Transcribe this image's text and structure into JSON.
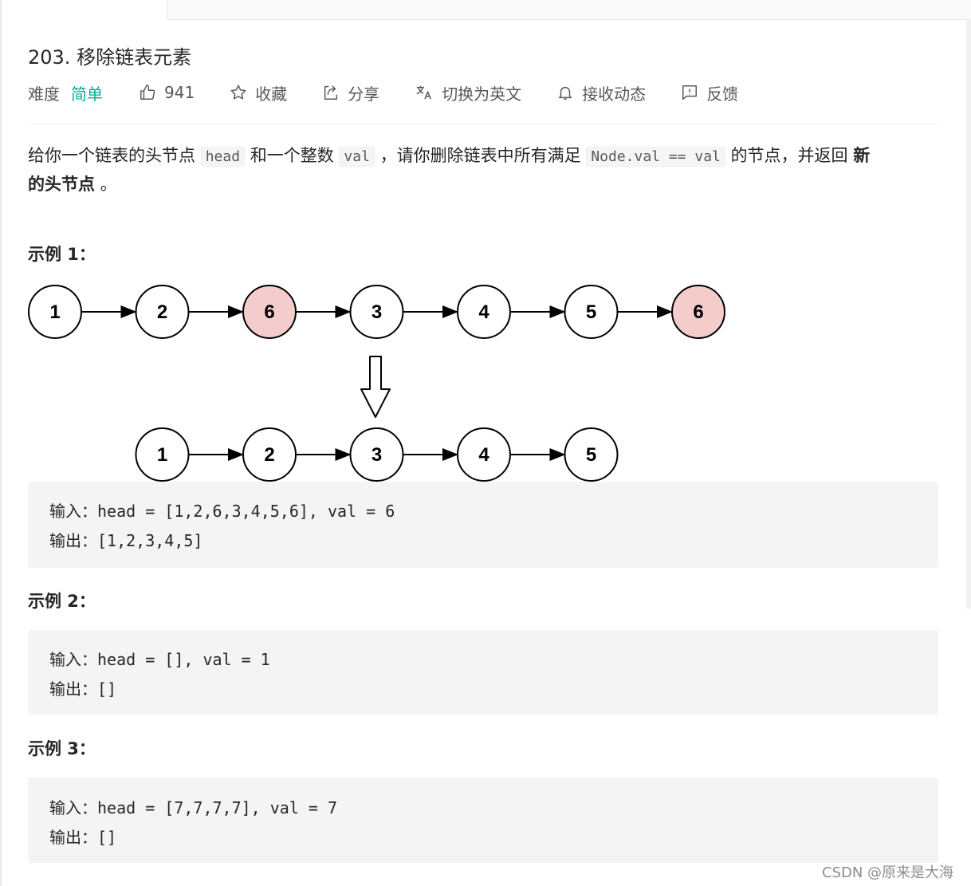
{
  "problem": {
    "title": "203. 移除链表元素",
    "difficulty_label": "难度",
    "difficulty": "简单",
    "likes": "941",
    "favorite": "收藏",
    "share": "分享",
    "translate": "切换为英文",
    "notify": "接收动态",
    "feedback": "反馈"
  },
  "description": {
    "p1": "给你一个链表的头节点",
    "code_head": "head",
    "p2": "和一个整数",
    "code_val": "val",
    "p3": "，请你删除链表中所有满足",
    "code_cond": "Node.val == val",
    "p4": "的节点，并返回",
    "bold_new": "新",
    "bold_rest": "的头节点",
    "p5": "。"
  },
  "examples": [
    {
      "heading": "示例 1：",
      "input": "输入：head = [1,2,6,3,4,5,6], val = 6",
      "output": "输出：[1,2,3,4,5]"
    },
    {
      "heading": "示例 2：",
      "input": "输入：head = [], val = 1",
      "output": "输出：[]"
    },
    {
      "heading": "示例 3：",
      "input": "输入：head = [7,7,7,7], val = 7",
      "output": "输出：[]"
    }
  ],
  "diagram": {
    "before": [
      "1",
      "2",
      "6",
      "3",
      "4",
      "5",
      "6"
    ],
    "removed_flags": [
      false,
      false,
      true,
      false,
      false,
      false,
      true
    ],
    "after": [
      "1",
      "2",
      "3",
      "4",
      "5"
    ],
    "removed_color": "#f4cccc"
  },
  "watermark": "CSDN @原来是大海",
  "colors": {
    "accent": "#00af9b"
  }
}
